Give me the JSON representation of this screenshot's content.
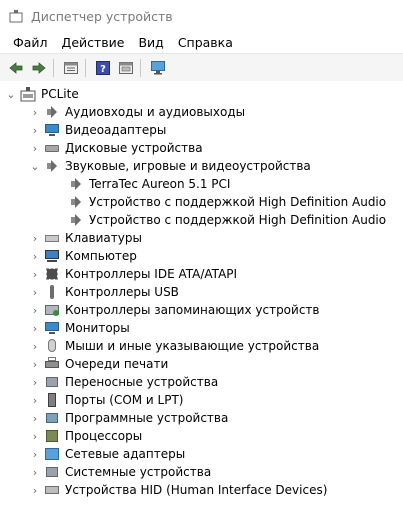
{
  "window": {
    "title": "Диспетчер устройств"
  },
  "menu": [
    "Файл",
    "Действие",
    "Вид",
    "Справка"
  ],
  "toolbar": {
    "buttons": [
      "back-arrow-icon",
      "forward-arrow-icon",
      "properties-icon",
      "help-icon",
      "update-driver-icon",
      "scan-hardware-icon"
    ]
  },
  "tree": {
    "root": "PCLite",
    "categories": [
      {
        "label": "Аудиовходы и аудиовыходы",
        "icon": "speaker-icon"
      },
      {
        "label": "Видеоадаптеры",
        "icon": "monitor-icon"
      },
      {
        "label": "Дисковые устройства",
        "icon": "disk-icon"
      },
      {
        "label": "Звуковые, игровые и видеоустройства",
        "icon": "speaker-icon",
        "expanded": true,
        "children": [
          "TerraTec Aureon 5.1 PCI",
          "Устройство с поддержкой High Definition Audio",
          "Устройство с поддержкой High Definition Audio"
        ]
      },
      {
        "label": "Клавиатуры",
        "icon": "keyboard-icon"
      },
      {
        "label": "Компьютер",
        "icon": "computer-icon"
      },
      {
        "label": "Контроллеры IDE ATA/ATAPI",
        "icon": "chip-icon"
      },
      {
        "label": "Контроллеры USB",
        "icon": "usb-icon"
      },
      {
        "label": "Контроллеры запоминающих устройств",
        "icon": "storage-icon"
      },
      {
        "label": "Мониторы",
        "icon": "monitor-icon"
      },
      {
        "label": "Мыши и иные указывающие устройства",
        "icon": "mouse-icon"
      },
      {
        "label": "Очереди печати",
        "icon": "printer-icon"
      },
      {
        "label": "Переносные устройства",
        "icon": "box-icon"
      },
      {
        "label": "Порты (COM и LPT)",
        "icon": "port-icon"
      },
      {
        "label": "Программные устройства",
        "icon": "prog-icon"
      },
      {
        "label": "Процессоры",
        "icon": "cpu-icon"
      },
      {
        "label": "Сетевые адаптеры",
        "icon": "network-icon"
      },
      {
        "label": "Системные устройства",
        "icon": "box-icon"
      },
      {
        "label": "Устройства HID (Human Interface Devices)",
        "icon": "hid-icon"
      }
    ]
  }
}
